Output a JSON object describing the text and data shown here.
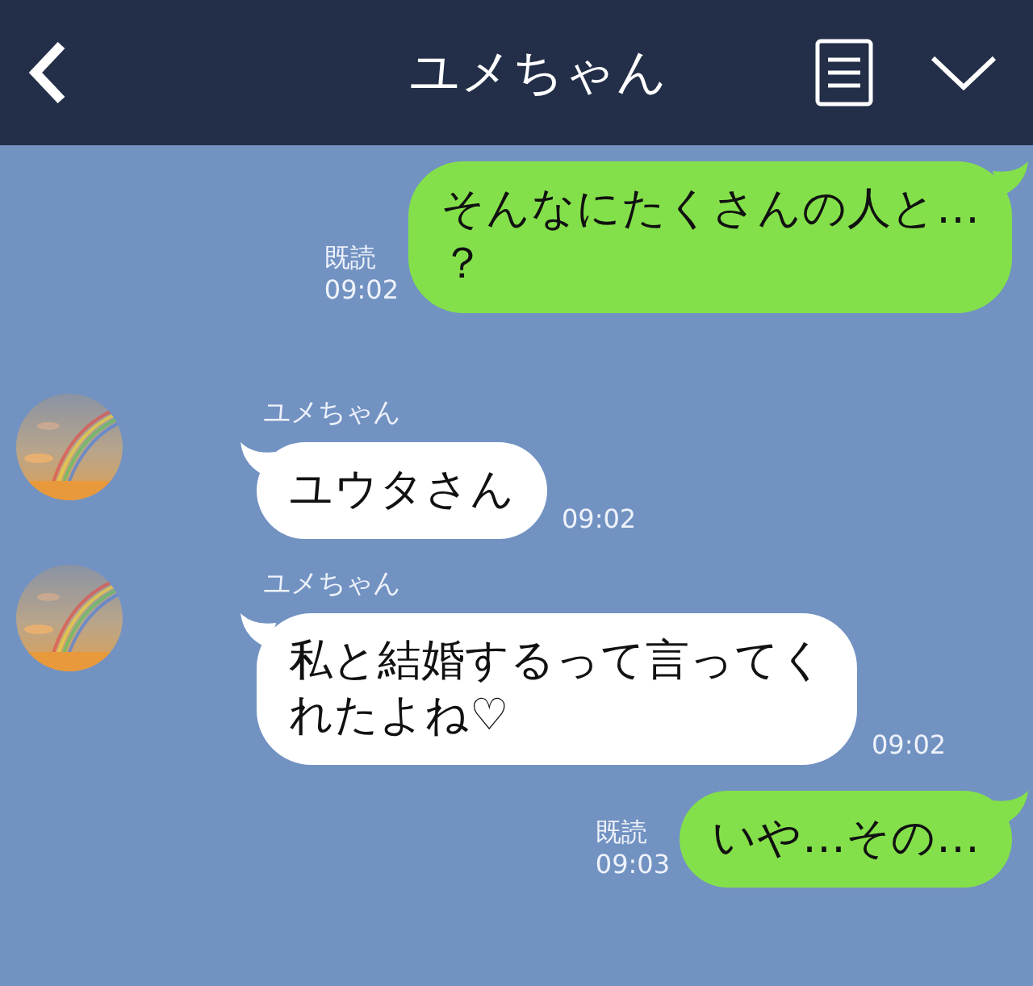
{
  "header": {
    "title": "ユメちゃん"
  },
  "messages": [
    {
      "kind": "sent",
      "lines": [
        "そんなにたくさんの人と…",
        "？"
      ],
      "read_label": "既読",
      "time": "09:02"
    },
    {
      "kind": "received",
      "sender": "ユメちゃん",
      "lines": [
        "ユウタさん"
      ],
      "time": "09:02"
    },
    {
      "kind": "received",
      "sender": "ユメちゃん",
      "lines": [
        "私と結婚するって言ってく",
        "れたよね♡"
      ],
      "time": "09:02"
    },
    {
      "kind": "sent",
      "lines": [
        "いや…その…"
      ],
      "read_label": "既読",
      "time": "09:03"
    }
  ]
}
